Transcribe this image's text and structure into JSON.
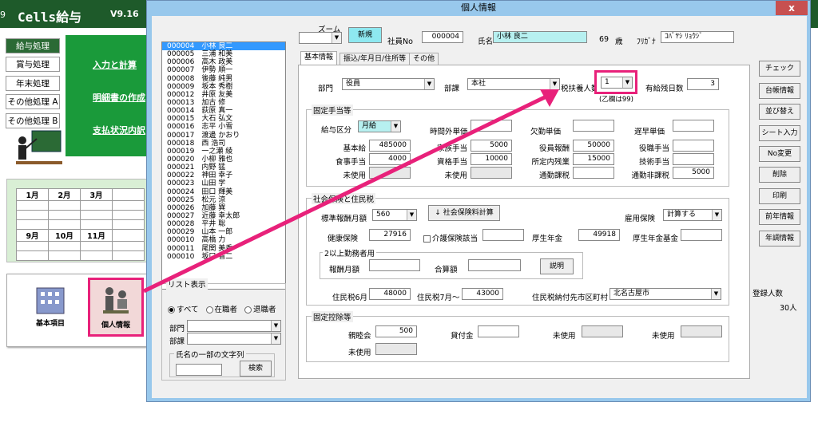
{
  "app": {
    "title": "Cells給与",
    "version": "V9.16",
    "edge_num": "9"
  },
  "nav": [
    "給与処理",
    "賞与処理",
    "年末処理",
    "その他処理 A",
    "その他処理 B"
  ],
  "links": [
    "入力と計算",
    "明細書の作成",
    "支払状況内訳"
  ],
  "calendar": {
    "row1": [
      "1月",
      "2月",
      "3月"
    ],
    "row2": [
      "9月",
      "10月",
      "11月"
    ]
  },
  "bottom": {
    "basic": "基本項目",
    "personal": "個人情報"
  },
  "window": {
    "title": "個人情報",
    "close": "x"
  },
  "list": {
    "items": [
      "000004　小林 良二",
      "000005　三浦 和美",
      "000006　高木 政美",
      "000007　伊勢 順一",
      "000008　後藤 純男",
      "000009　坂本 秀樹",
      "000012　井原 友美",
      "000013　加古 修",
      "000014　荻原 真一",
      "000015　大石 弘文",
      "000016　志平 小雪",
      "000017　渡邊 かおり",
      "000018　西 浩司",
      "000019　一之瀬 綾",
      "000020　小柳 雅也",
      "000021　内野 猛",
      "000022　神田 幸子",
      "000023　山田 学",
      "000024　田口 輝美",
      "000025　松元 涼",
      "000026　加藤 巽",
      "000027　近藤 幸太郎",
      "000028　平井 聡",
      "000029　山本 一郎",
      "000010　高橋 力",
      "000011　尾関 美香",
      "000010　坂口 省二"
    ],
    "selected": 0
  },
  "list_filter": {
    "legend": "リスト表示",
    "r_all": "すべて",
    "r_active": "在職者",
    "r_retired": "退職者",
    "dept": "部門",
    "section": "部課",
    "name_part": "氏名の一部の文字列",
    "search": "検索"
  },
  "zoom": {
    "label": "ズーム",
    "value": ""
  },
  "header": {
    "new": "新規",
    "emp_no_label": "社員No",
    "emp_no": "000004",
    "name_label": "氏名",
    "name": "小林 良二",
    "age": "69",
    "age_unit": "歳",
    "kana_label": "ﾌﾘｶﾞﾅ",
    "kana": "ｺﾊﾞﾔｼ ﾘｮｳｼﾞ"
  },
  "tabs": [
    "基本情報",
    "振込/年月日/住所等",
    "その他"
  ],
  "basic": {
    "dept_label": "部門",
    "dept": "役員",
    "section_label": "部課",
    "section": "本社",
    "dependents_label": "税扶養人数",
    "dependents": "1",
    "dependents_note": "(乙欄は99)",
    "leave_label": "有給残日数",
    "leave": "3"
  },
  "fixed": {
    "legend": "固定手当等",
    "pay_type_label": "給与区分",
    "pay_type": "月給",
    "overtime_rate": "時間外単価",
    "absence_rate": "欠勤単価",
    "late_rate": "遅早単価",
    "c1": [
      [
        "基本給",
        "485000"
      ],
      [
        "食事手当",
        "4000"
      ],
      [
        "未使用",
        ""
      ]
    ],
    "c2": [
      [
        "家族手当",
        "5000"
      ],
      [
        "資格手当",
        "10000"
      ],
      [
        "未使用",
        ""
      ]
    ],
    "c3": [
      [
        "役員報酬",
        "50000"
      ],
      [
        "所定内残業",
        "15000"
      ],
      [
        "通勤課税",
        ""
      ]
    ],
    "c4": [
      [
        "役職手当",
        ""
      ],
      [
        "技術手当",
        ""
      ],
      [
        "通勤非課税",
        "5000"
      ]
    ]
  },
  "ins": {
    "legend": "社会保険と住民税",
    "std_label": "標準報酬月額",
    "std": "560",
    "calc": "社会保険料計算",
    "employment_label": "雇用保険",
    "employment": "計算する",
    "health_label": "健康保険",
    "health": "27916",
    "care_label": "介護保険該当",
    "pension_label": "厚生年金",
    "pension": "49918",
    "fund_label": "厚生年金基金",
    "multi_legend": "2以上勤務者用",
    "multi_pay": "報酬月額",
    "multi_total": "合算額",
    "explain": "説明",
    "res6_label": "住民税6月",
    "res6": "48000",
    "res7_label": "住民税7月～",
    "res7": "43000",
    "city_label": "住民税納付先市区町村",
    "city": "北名古屋市"
  },
  "deduct": {
    "legend": "固定控除等",
    "club_label": "親睦会",
    "club": "500",
    "loan_label": "貸付金",
    "unused": "未使用"
  },
  "right_buttons": [
    "チェック",
    "台帳情報",
    "並び替え",
    "シート入力",
    "No変更",
    "削除",
    "印刷",
    "前年情報",
    "年調情報"
  ],
  "count": {
    "label": "登録人数",
    "value": "30人"
  },
  "colors": {
    "accent": "#e8217a",
    "title_bg": "#1e5a2a",
    "window": "#98c8ec"
  }
}
